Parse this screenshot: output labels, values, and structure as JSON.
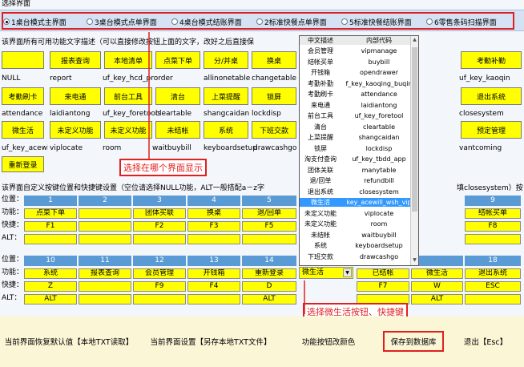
{
  "header": {
    "section_title": "选择界面"
  },
  "radios": [
    {
      "label": "1桌台模式主界面",
      "selected": true
    },
    {
      "label": "3桌台模式点单界面",
      "selected": false
    },
    {
      "label": "4桌台模式结账界面",
      "selected": false
    },
    {
      "label": "2标准快餐点单界面",
      "selected": false
    },
    {
      "label": "5标准快餐结账界面",
      "selected": false
    },
    {
      "label": "6零售条码扫描界面",
      "selected": false
    }
  ],
  "description": "该界面所有可用功能文字描述（可以直接修改按钮上面的文字，改好之后直接保",
  "func_rows": [
    {
      "buttons": [
        "",
        "报表查询",
        "本地清单",
        "点菜下单",
        "分/并桌",
        "换桌"
      ],
      "keys": [
        "NULL",
        "report",
        "uf_key_hcd_prorder",
        "",
        "allinonetable",
        "changetable"
      ]
    },
    {
      "buttons": [
        "考勤刷卡",
        "来电通",
        "前台工具",
        "清台",
        "上菜提醒",
        "锁屏"
      ],
      "keys": [
        "attendance",
        "laidiantong",
        "uf_key_foretools",
        "cleartable",
        "shangcaidan",
        "lockdisp"
      ]
    },
    {
      "buttons": [
        "微生活",
        "未定义功能",
        "未定义功能",
        "未结帐",
        "系统",
        "下班交款"
      ],
      "keys": [
        "uf_key_acewill_wsh",
        "viplocate",
        "room",
        "waitbuybill",
        "keyboardsetup",
        "drawcashgo"
      ]
    }
  ],
  "func_right": {
    "buttons": [
      "考勤补勤",
      "退出系统",
      "预定管理"
    ],
    "keys": [
      "uf_key_kaoqin",
      "closesystem",
      "vantcoming"
    ]
  },
  "relogin_button": "重新登录",
  "config_note": "该界面自定义按键位置和快捷键设置（空位请选择NULL功能，ALT一般搭配a－z字",
  "config_note_tail": "填closesystem）按",
  "config_labels": {
    "position": "位置：",
    "function": "功能：",
    "shortcut": "快捷：",
    "alt": "ALT："
  },
  "config_rows": [
    {
      "positions": [
        "1",
        "2",
        "3",
        "4",
        "5",
        "",
        "",
        "",
        "9"
      ],
      "functions": [
        "点菜下单",
        "",
        "团体买联",
        "换桌",
        "退/回单",
        "",
        "",
        "",
        "结帐买单"
      ],
      "shortcuts": [
        "F1",
        "",
        "F2",
        "F3",
        "F5",
        "",
        "",
        "",
        "F8"
      ],
      "alts": [
        "",
        "",
        "",
        "",
        "",
        "",
        "",
        "",
        ""
      ]
    },
    {
      "positions": [
        "10",
        "11",
        "12",
        "13",
        "14",
        "",
        "",
        "",
        "18"
      ],
      "functions": [
        "系统",
        "报表查询",
        "会员管理",
        "开钱箱",
        "重新登录",
        "微生活",
        "已结帐",
        "微生活",
        "退出系统"
      ],
      "shortcuts": [
        "Z",
        "",
        "F9",
        "F4",
        "D",
        "",
        "F7",
        "W",
        "ESC"
      ],
      "alts": [
        "ALT",
        "",
        "",
        "",
        "ALT",
        "",
        "",
        "ALT",
        ""
      ]
    }
  ],
  "dropdown": {
    "columns": [
      "中文描述",
      "内部代码"
    ],
    "rows": [
      [
        "会员管理",
        "vipmanage"
      ],
      [
        "结帐买单",
        "buybill"
      ],
      [
        "开钱箱",
        "opendrawer"
      ],
      [
        "考勤补勤",
        "f_key_kaoqing_buqin"
      ],
      [
        "考勤刷卡",
        "attendance"
      ],
      [
        "来电通",
        "laidiantong"
      ],
      [
        "前台工具",
        "uf_key_foretool"
      ],
      [
        "清台",
        "cleartable"
      ],
      [
        "上菜提醒",
        "shangcaidan"
      ],
      [
        "锁屏",
        "lockdisp"
      ],
      [
        "淘支付查询",
        "uf_key_tbdd_app"
      ],
      [
        "团体关联",
        "manytable"
      ],
      [
        "退/回单",
        "refundbill"
      ],
      [
        "退出系统",
        "closesystem"
      ],
      [
        "微生活",
        "key_acewill_wsh_vip"
      ],
      [
        "未定义功能",
        "viplocate"
      ],
      [
        "未定义功能",
        "room"
      ],
      [
        "未结帐",
        "waitbuybill"
      ],
      [
        "系统",
        "keyboardsetup"
      ],
      [
        "下班交款",
        "drawcashgo"
      ]
    ],
    "selected_index": 14
  },
  "annotations": {
    "choose_screen": "选择在哪个界面显示",
    "choose_button": "选择微生活按钮、快捷键"
  },
  "bottom_buttons": [
    "当前界面恢复默认值【本地TXT读取】",
    "当前界面设置【另存本地TXT文件】",
    "功能按钮改颜色",
    "保存到数据库",
    "退出【Esc】"
  ],
  "colors": {
    "accent_red": "#e02020",
    "button_yellow": "#ffff00",
    "header_blue": "#5b9bd5",
    "selection_blue": "#3399ff"
  }
}
